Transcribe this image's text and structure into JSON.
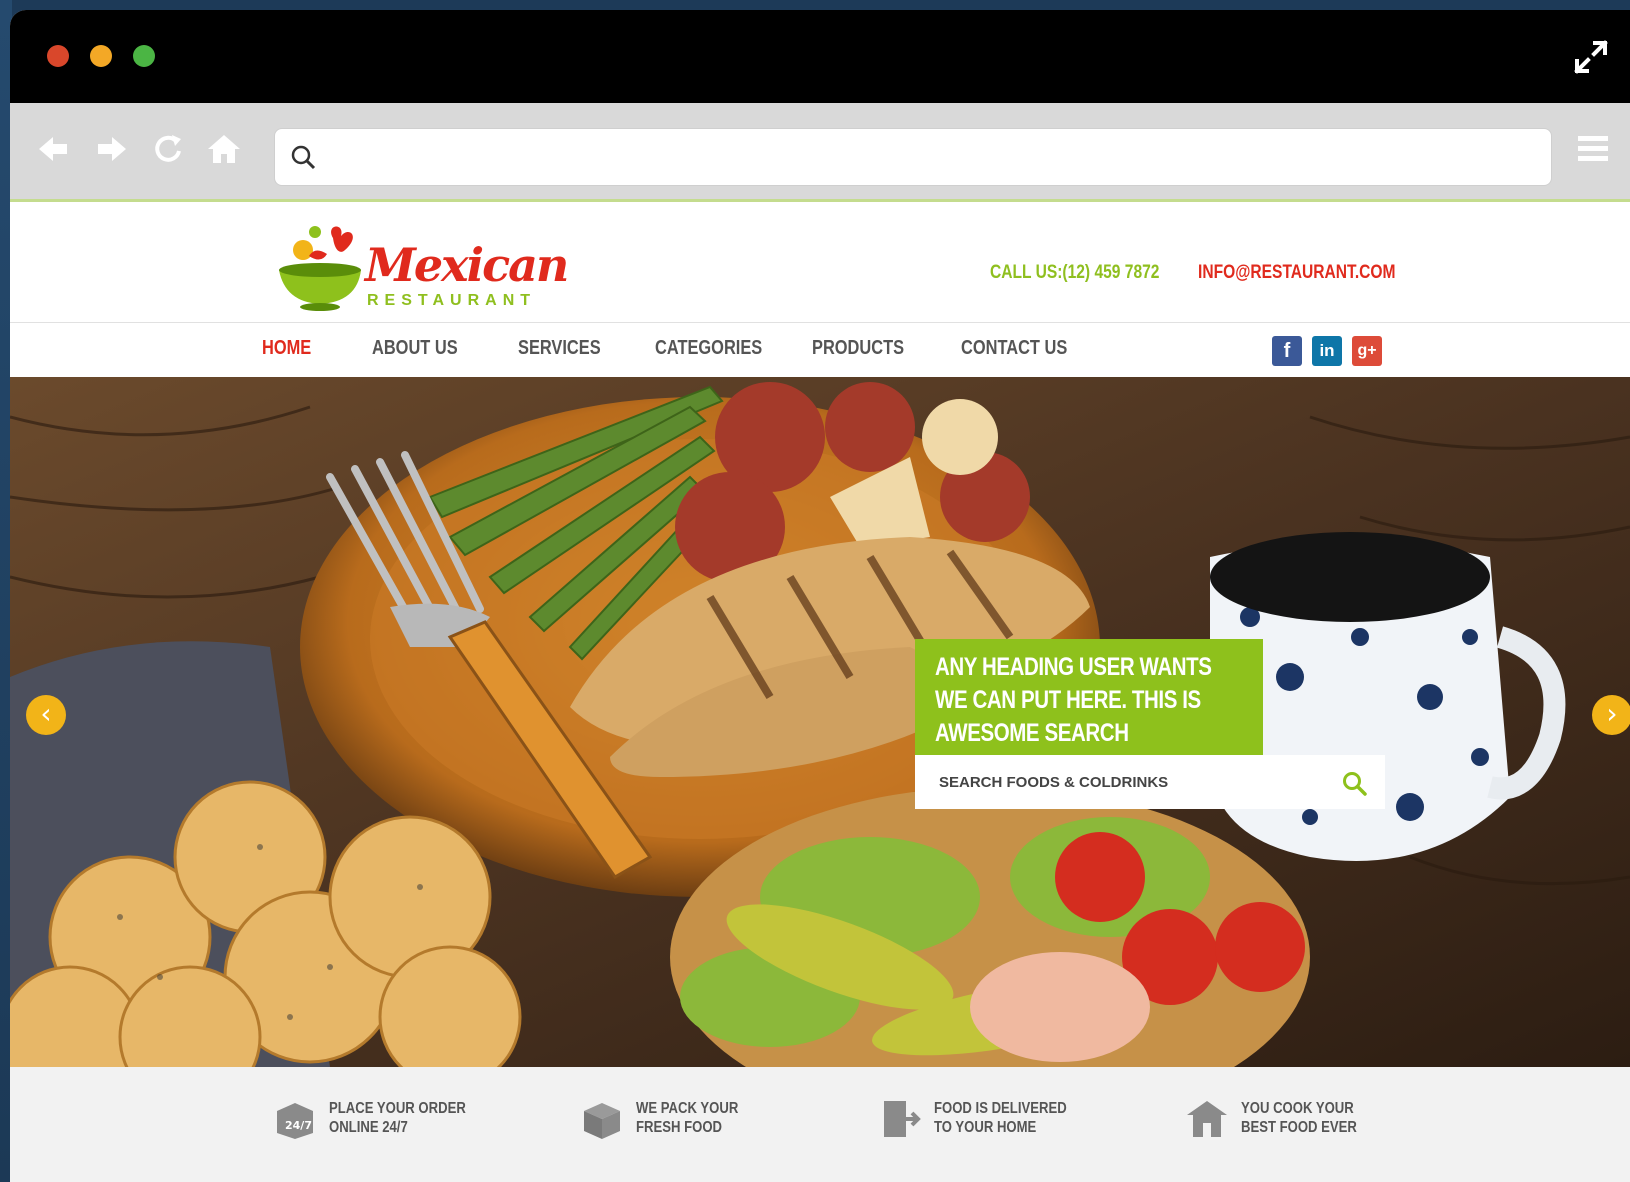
{
  "browser": {
    "controls": [
      "close-dot",
      "minimize-dot",
      "maximize-dot"
    ],
    "address_value": "",
    "icons": [
      "back-arrow-icon",
      "forward-arrow-icon",
      "reload-icon",
      "home-icon",
      "search-icon",
      "menu-icon",
      "expand-icon"
    ]
  },
  "site": {
    "logo": {
      "word": "Mexican",
      "sub": "RESTAURANT"
    },
    "contact": {
      "phone": "CALL US:(12) 459 7872",
      "email": "INFO@RESTAURANT.COM"
    },
    "nav": [
      {
        "label": "HOME",
        "active": true
      },
      {
        "label": "ABOUT US",
        "active": false
      },
      {
        "label": "SERVICES",
        "active": false
      },
      {
        "label": "CATEGORIES",
        "active": false
      },
      {
        "label": "PRODUCTS",
        "active": false
      },
      {
        "label": "CONTACT US",
        "active": false
      }
    ],
    "social": {
      "facebook": "f",
      "linkedin": "in",
      "googleplus": "g+"
    }
  },
  "hero": {
    "heading": "ANY HEADING USER WANTS WE CAN PUT HERE. THIS IS AWESOME SEARCH BAR..INDEED",
    "search_placeholder": "SEARCH FOODS & COLDRINKS",
    "prev": "‹",
    "next": "›"
  },
  "features": [
    {
      "line1": "PLACE YOUR ORDER",
      "line2": "ONLINE 24/7",
      "icon": "24-7-box-icon"
    },
    {
      "line1": "WE PACK YOUR",
      "line2": "FRESH FOOD",
      "icon": "package-icon"
    },
    {
      "line1": "FOOD IS DELIVERED",
      "line2": "TO YOUR HOME",
      "icon": "delivery-door-icon"
    },
    {
      "line1": "YOU COOK YOUR",
      "line2": "BEST FOOD EVER",
      "icon": "home-cook-icon"
    }
  ],
  "colors": {
    "brand_red": "#e02a1d",
    "brand_green": "#8ec11c",
    "accent_yellow": "#f2b418"
  }
}
